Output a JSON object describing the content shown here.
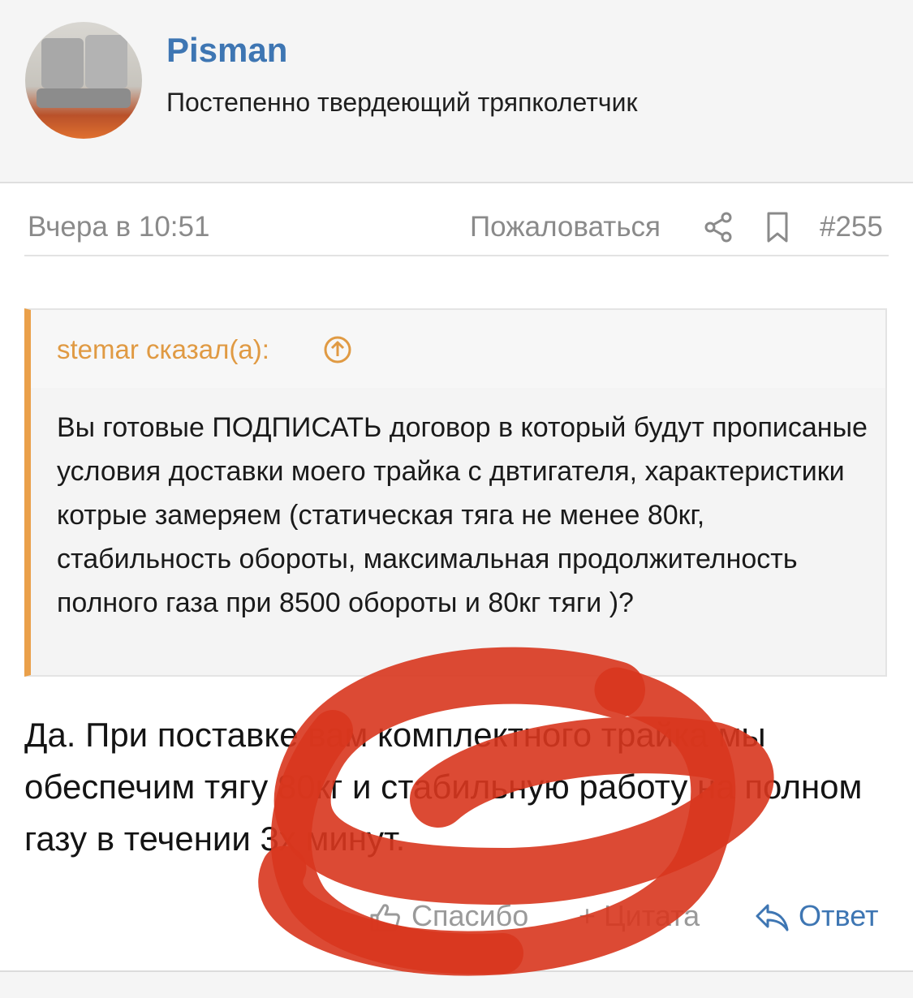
{
  "user": {
    "name": "Pisman",
    "title": "Постепенно твердеющий тряпколетчик"
  },
  "meta": {
    "date": "Вчера в 10:51",
    "report": "Пожаловаться",
    "post_number": "#255"
  },
  "quote": {
    "author": "stemar сказал(а):",
    "text": "Вы готовые ПОДПИСАТЬ договор в который будут прописаные условия доставки моего трайка с двтигателя, характеристики котрые замеряем (статическая тяга не менее 80кг, стабильность обороты, максимальная продолжителность полного газа при 8500 обороты и 80кг тяги )?"
  },
  "reply": {
    "text": "Да. При поставке вам комплектного трайка мы обеспечим тягу 80кг и стабильную работу на полном газу в течении 3х минут."
  },
  "actions": {
    "like": "Спасибо",
    "quote": "+ Цитата",
    "reply": "Ответ"
  },
  "colors": {
    "accent_blue": "#3e76b3",
    "quote_orange": "#eaa04a",
    "scribble_red": "#d8361e"
  }
}
